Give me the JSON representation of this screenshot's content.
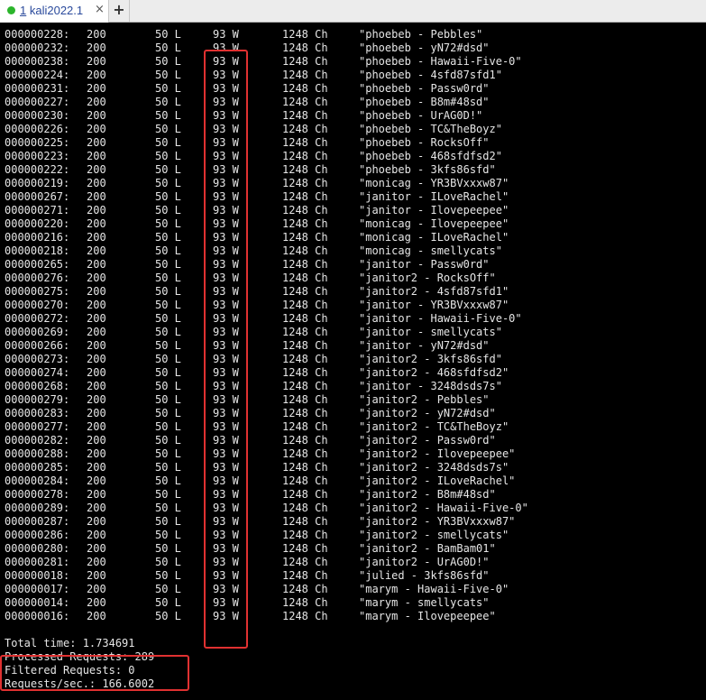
{
  "tab": {
    "number": "1",
    "name": "kali2022.1",
    "close_glyph": "×",
    "add_glyph": "+",
    "status_color": "#2bb52b"
  },
  "highlight_color": "#e03131",
  "rows": [
    {
      "id": "000000228:",
      "response": "200",
      "lines": "50 L",
      "words": "93 W",
      "chars": "1248 Ch",
      "payload": "\"phoebeb - Pebbles\""
    },
    {
      "id": "000000232:",
      "response": "200",
      "lines": "50 L",
      "words": "93 W",
      "chars": "1248 Ch",
      "payload": "\"phoebeb - yN72#dsd\""
    },
    {
      "id": "000000238:",
      "response": "200",
      "lines": "50 L",
      "words": "93 W",
      "chars": "1248 Ch",
      "payload": "\"phoebeb - Hawaii-Five-0\""
    },
    {
      "id": "000000224:",
      "response": "200",
      "lines": "50 L",
      "words": "93 W",
      "chars": "1248 Ch",
      "payload": "\"phoebeb - 4sfd87sfd1\""
    },
    {
      "id": "000000231:",
      "response": "200",
      "lines": "50 L",
      "words": "93 W",
      "chars": "1248 Ch",
      "payload": "\"phoebeb - Passw0rd\""
    },
    {
      "id": "000000227:",
      "response": "200",
      "lines": "50 L",
      "words": "93 W",
      "chars": "1248 Ch",
      "payload": "\"phoebeb - B8m#48sd\""
    },
    {
      "id": "000000230:",
      "response": "200",
      "lines": "50 L",
      "words": "93 W",
      "chars": "1248 Ch",
      "payload": "\"phoebeb - UrAG0D!\""
    },
    {
      "id": "000000226:",
      "response": "200",
      "lines": "50 L",
      "words": "93 W",
      "chars": "1248 Ch",
      "payload": "\"phoebeb - TC&TheBoyz\""
    },
    {
      "id": "000000225:",
      "response": "200",
      "lines": "50 L",
      "words": "93 W",
      "chars": "1248 Ch",
      "payload": "\"phoebeb - RocksOff\""
    },
    {
      "id": "000000223:",
      "response": "200",
      "lines": "50 L",
      "words": "93 W",
      "chars": "1248 Ch",
      "payload": "\"phoebeb - 468sfdfsd2\""
    },
    {
      "id": "000000222:",
      "response": "200",
      "lines": "50 L",
      "words": "93 W",
      "chars": "1248 Ch",
      "payload": "\"phoebeb - 3kfs86sfd\""
    },
    {
      "id": "000000219:",
      "response": "200",
      "lines": "50 L",
      "words": "93 W",
      "chars": "1248 Ch",
      "payload": "\"monicag - YR3BVxxxw87\""
    },
    {
      "id": "000000267:",
      "response": "200",
      "lines": "50 L",
      "words": "93 W",
      "chars": "1248 Ch",
      "payload": "\"janitor - ILoveRachel\""
    },
    {
      "id": "000000271:",
      "response": "200",
      "lines": "50 L",
      "words": "93 W",
      "chars": "1248 Ch",
      "payload": "\"janitor - Ilovepeepee\""
    },
    {
      "id": "000000220:",
      "response": "200",
      "lines": "50 L",
      "words": "93 W",
      "chars": "1248 Ch",
      "payload": "\"monicag - Ilovepeepee\""
    },
    {
      "id": "000000216:",
      "response": "200",
      "lines": "50 L",
      "words": "93 W",
      "chars": "1248 Ch",
      "payload": "\"monicag - ILoveRachel\""
    },
    {
      "id": "000000218:",
      "response": "200",
      "lines": "50 L",
      "words": "93 W",
      "chars": "1248 Ch",
      "payload": "\"monicag - smellycats\""
    },
    {
      "id": "000000265:",
      "response": "200",
      "lines": "50 L",
      "words": "93 W",
      "chars": "1248 Ch",
      "payload": "\"janitor - Passw0rd\""
    },
    {
      "id": "000000276:",
      "response": "200",
      "lines": "50 L",
      "words": "93 W",
      "chars": "1248 Ch",
      "payload": "\"janitor2 - RocksOff\""
    },
    {
      "id": "000000275:",
      "response": "200",
      "lines": "50 L",
      "words": "93 W",
      "chars": "1248 Ch",
      "payload": "\"janitor2 - 4sfd87sfd1\""
    },
    {
      "id": "000000270:",
      "response": "200",
      "lines": "50 L",
      "words": "93 W",
      "chars": "1248 Ch",
      "payload": "\"janitor - YR3BVxxxw87\""
    },
    {
      "id": "000000272:",
      "response": "200",
      "lines": "50 L",
      "words": "93 W",
      "chars": "1248 Ch",
      "payload": "\"janitor - Hawaii-Five-0\""
    },
    {
      "id": "000000269:",
      "response": "200",
      "lines": "50 L",
      "words": "93 W",
      "chars": "1248 Ch",
      "payload": "\"janitor - smellycats\""
    },
    {
      "id": "000000266:",
      "response": "200",
      "lines": "50 L",
      "words": "93 W",
      "chars": "1248 Ch",
      "payload": "\"janitor - yN72#dsd\""
    },
    {
      "id": "000000273:",
      "response": "200",
      "lines": "50 L",
      "words": "93 W",
      "chars": "1248 Ch",
      "payload": "\"janitor2 - 3kfs86sfd\""
    },
    {
      "id": "000000274:",
      "response": "200",
      "lines": "50 L",
      "words": "93 W",
      "chars": "1248 Ch",
      "payload": "\"janitor2 - 468sfdfsd2\""
    },
    {
      "id": "000000268:",
      "response": "200",
      "lines": "50 L",
      "words": "93 W",
      "chars": "1248 Ch",
      "payload": "\"janitor - 3248dsds7s\""
    },
    {
      "id": "000000279:",
      "response": "200",
      "lines": "50 L",
      "words": "93 W",
      "chars": "1248 Ch",
      "payload": "\"janitor2 - Pebbles\""
    },
    {
      "id": "000000283:",
      "response": "200",
      "lines": "50 L",
      "words": "93 W",
      "chars": "1248 Ch",
      "payload": "\"janitor2 - yN72#dsd\""
    },
    {
      "id": "000000277:",
      "response": "200",
      "lines": "50 L",
      "words": "93 W",
      "chars": "1248 Ch",
      "payload": "\"janitor2 - TC&TheBoyz\""
    },
    {
      "id": "000000282:",
      "response": "200",
      "lines": "50 L",
      "words": "93 W",
      "chars": "1248 Ch",
      "payload": "\"janitor2 - Passw0rd\""
    },
    {
      "id": "000000288:",
      "response": "200",
      "lines": "50 L",
      "words": "93 W",
      "chars": "1248 Ch",
      "payload": "\"janitor2 - Ilovepeepee\""
    },
    {
      "id": "000000285:",
      "response": "200",
      "lines": "50 L",
      "words": "93 W",
      "chars": "1248 Ch",
      "payload": "\"janitor2 - 3248dsds7s\""
    },
    {
      "id": "000000284:",
      "response": "200",
      "lines": "50 L",
      "words": "93 W",
      "chars": "1248 Ch",
      "payload": "\"janitor2 - ILoveRachel\""
    },
    {
      "id": "000000278:",
      "response": "200",
      "lines": "50 L",
      "words": "93 W",
      "chars": "1248 Ch",
      "payload": "\"janitor2 - B8m#48sd\""
    },
    {
      "id": "000000289:",
      "response": "200",
      "lines": "50 L",
      "words": "93 W",
      "chars": "1248 Ch",
      "payload": "\"janitor2 - Hawaii-Five-0\""
    },
    {
      "id": "000000287:",
      "response": "200",
      "lines": "50 L",
      "words": "93 W",
      "chars": "1248 Ch",
      "payload": "\"janitor2 - YR3BVxxxw87\""
    },
    {
      "id": "000000286:",
      "response": "200",
      "lines": "50 L",
      "words": "93 W",
      "chars": "1248 Ch",
      "payload": "\"janitor2 - smellycats\""
    },
    {
      "id": "000000280:",
      "response": "200",
      "lines": "50 L",
      "words": "93 W",
      "chars": "1248 Ch",
      "payload": "\"janitor2 - BamBam01\""
    },
    {
      "id": "000000281:",
      "response": "200",
      "lines": "50 L",
      "words": "93 W",
      "chars": "1248 Ch",
      "payload": "\"janitor2 - UrAG0D!\""
    },
    {
      "id": "000000018:",
      "response": "200",
      "lines": "50 L",
      "words": "93 W",
      "chars": "1248 Ch",
      "payload": "\"julied - 3kfs86sfd\""
    },
    {
      "id": "000000017:",
      "response": "200",
      "lines": "50 L",
      "words": "93 W",
      "chars": "1248 Ch",
      "payload": "\"marym - Hawaii-Five-0\""
    },
    {
      "id": "000000014:",
      "response": "200",
      "lines": "50 L",
      "words": "93 W",
      "chars": "1248 Ch",
      "payload": "\"marym - smellycats\""
    },
    {
      "id": "000000016:",
      "response": "200",
      "lines": "50 L",
      "words": "93 W",
      "chars": "1248 Ch",
      "payload": "\"marym - Ilovepeepee\""
    }
  ],
  "summary": [
    "Total time: 1.734691",
    "Processed Requests: 289",
    "Filtered Requests: 0",
    "Requests/sec.: 166.6002"
  ]
}
